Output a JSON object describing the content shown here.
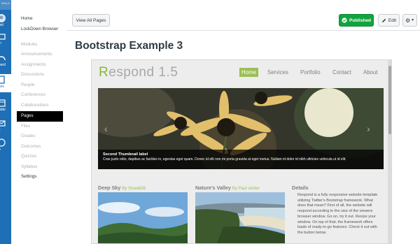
{
  "global_nav": {
    "logo_text": "WILLE",
    "items": [
      {
        "label": "unt",
        "icon": "account-icon",
        "active": false
      },
      {
        "label": "in",
        "icon": "admin-icon",
        "active": false
      },
      {
        "label": "oard",
        "icon": "dashboard-icon",
        "active": false
      },
      {
        "label": "ses",
        "icon": "courses-icon",
        "active": true
      },
      {
        "label": "ndar",
        "icon": "calendar-icon",
        "active": false
      },
      {
        "label": "x",
        "icon": "inbox-icon",
        "active": false
      },
      {
        "label": "o",
        "icon": "help-icon",
        "active": false
      }
    ],
    "colors": {
      "background": "#1e6fb6"
    }
  },
  "course_nav": {
    "items": [
      {
        "label": "Home",
        "enabled": true
      },
      {
        "label": "LockDown Browser",
        "enabled": true
      },
      {
        "label": "Modules",
        "enabled": false
      },
      {
        "label": "Announcements",
        "enabled": false
      },
      {
        "label": "Assignments",
        "enabled": false
      },
      {
        "label": "Discussions",
        "enabled": false
      },
      {
        "label": "People",
        "enabled": false
      },
      {
        "label": "Conferences",
        "enabled": false
      },
      {
        "label": "Collaborations",
        "enabled": false
      },
      {
        "label": "Pages",
        "enabled": true,
        "active": true
      },
      {
        "label": "Files",
        "enabled": false
      },
      {
        "label": "Grades",
        "enabled": false
      },
      {
        "label": "Outcomes",
        "enabled": false
      },
      {
        "label": "Quizzes",
        "enabled": false
      },
      {
        "label": "Syllabus",
        "enabled": false
      },
      {
        "label": "Settings",
        "enabled": true
      }
    ]
  },
  "toolbar": {
    "view_all_label": "View All Pages",
    "published_label": "Published",
    "edit_label": "Edit",
    "colors": {
      "published": "#12a33e"
    }
  },
  "page": {
    "title": "Bootstrap Example 3"
  },
  "embed": {
    "site_title_first": "R",
    "site_title_rest": "espond 1.5",
    "nav": [
      "Home",
      "Services",
      "Portfolio",
      "Contact",
      "About"
    ],
    "carousel": {
      "caption_title": "Second Thumbnail label",
      "caption_text": "Cras justo odio, dapibus ac facilisis in, egestas eget quam. Donec id elit non mi porta gravida at eget metus. Nullam id dolor id nibh ultricies vehicula ut id elit."
    },
    "columns": [
      {
        "title": "Deep Sky",
        "by": "By Snwa836"
      },
      {
        "title": "Nature's Valley",
        "by": "By Paul venter"
      },
      {
        "title": "Details",
        "by": ""
      }
    ],
    "details_text": "Respond is a fully responsive website template utilizing Twitter's Bootstrap framework. What does that mean? First of all, the website will respond according to the size of the viewers browser window. Go on, try it out. Resize your window. On top of that, the framework offers loads of ready-to-go features. Check it out with the button below.",
    "colors": {
      "accent": "#9bbf55",
      "title_gray": "#a8a8a8"
    }
  }
}
